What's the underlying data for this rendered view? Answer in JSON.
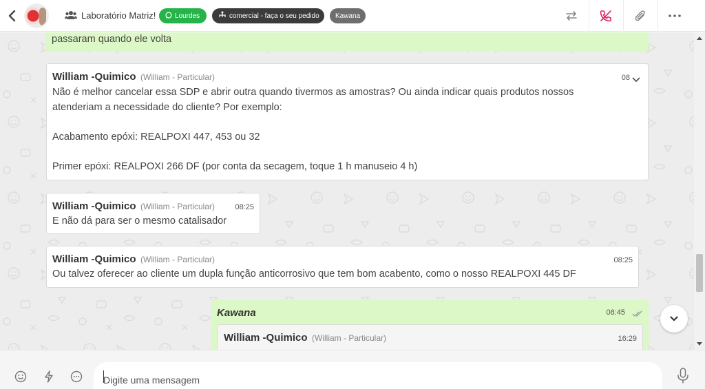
{
  "header": {
    "title": "Laboratório Matriz!",
    "tags": [
      {
        "label": "Lourdes",
        "color": "#25b34a"
      },
      {
        "label": "comercial - faça o seu pedido",
        "color": "#3b3b3b"
      },
      {
        "label": "Kawana",
        "color": "#6e6e6e"
      }
    ]
  },
  "messages": {
    "m0": {
      "text": "passaram quando ele volta"
    },
    "m1": {
      "sender": "William -Quimico",
      "sender_sub": "(William - Particular)",
      "time": "08",
      "lines": [
        "Não é melhor cancelar essa SDP e abrir outra quando tivermos as amostras? Ou ainda indicar quais produtos nossos",
        "atenderiam a necessidade do cliente? Por exemplo:",
        "",
        "Acabamento epóxi: REALPOXI 447, 453 ou 32",
        "",
        "Primer epóxi: REALPOXI 266 DF (por conta da secagem, toque 1 h manuseio 4 h)"
      ]
    },
    "m2": {
      "sender": "William -Quimico",
      "sender_sub": "(William - Particular)",
      "time": "08:25",
      "text": "E não dá para ser o mesmo catalisador"
    },
    "m3": {
      "sender": "William -Quimico",
      "sender_sub": "(William - Particular)",
      "time": "08:25",
      "text": "Ou talvez oferecer ao cliente um dupla função anticorrosivo que tem bom acabento, como o nosso REALPOXI 445 DF"
    },
    "m4": {
      "sender": "Kawana",
      "time": "08:45",
      "status": "read",
      "quote": {
        "sender": "William -Quimico",
        "sender_sub": "(William - Particular)",
        "time": "16:29"
      }
    }
  },
  "composer": {
    "placeholder": "Digite uma mensagem"
  },
  "colors": {
    "incoming_bubble": "#ffffff",
    "outgoing_bubble": "#dcf8c6",
    "chat_background": "#ededed",
    "accent_red": "#e0245e"
  },
  "icons": [
    "back-arrow-icon",
    "group-icon",
    "whatsapp-icon",
    "branch-icon",
    "transfer-icon",
    "end-call-icon",
    "paperclip-icon",
    "more-icon",
    "chevron-down-icon",
    "double-check-icon",
    "emoji-icon",
    "lightning-icon",
    "chat-dots-icon",
    "microphone-icon"
  ]
}
